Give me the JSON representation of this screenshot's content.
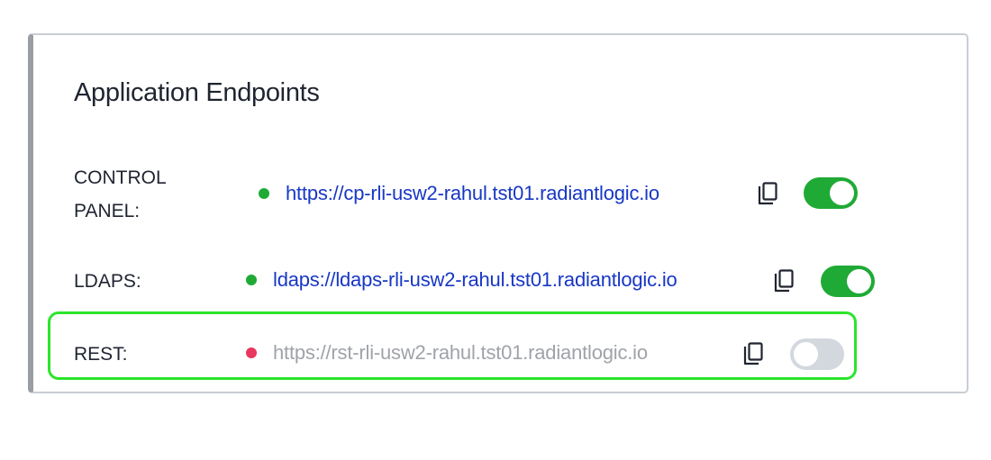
{
  "section": {
    "title": "Application Endpoints"
  },
  "endpoints": [
    {
      "label": "CONTROL PANEL:",
      "url": "https://cp-rli-usw2-rahul.tst01.radiantlogic.io",
      "status_color": "#1faa35",
      "url_color": "#1737c4",
      "enabled": true
    },
    {
      "label": "LDAPS:",
      "url": "ldaps://ldaps-rli-usw2-rahul.tst01.radiantlogic.io",
      "status_color": "#1faa35",
      "url_color": "#1737c4",
      "enabled": true
    },
    {
      "label": "REST:",
      "url": "https://rst-rli-usw2-rahul.tst01.radiantlogic.io",
      "status_color": "#e8365d",
      "url_color": "#9fa3a9",
      "enabled": false
    }
  ],
  "icons": {
    "copy": "copy-icon"
  },
  "colors": {
    "toggle_on": "#1faa35",
    "toggle_off": "#d3d8de",
    "highlight": "#2ae52a"
  }
}
